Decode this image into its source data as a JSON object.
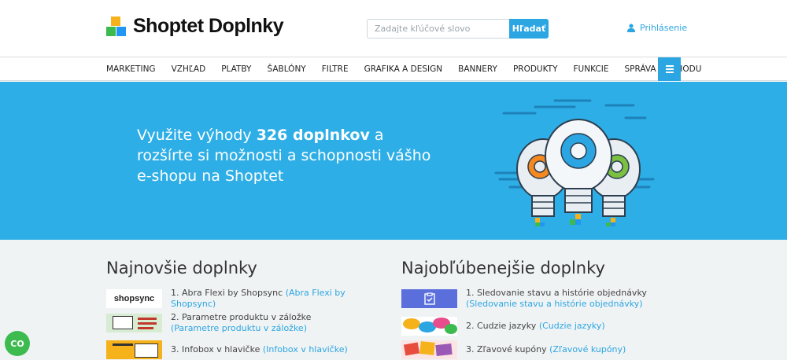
{
  "brand": {
    "name": "Shoptet Doplnky",
    "colors": {
      "yellow": "#f5b21a",
      "green": "#3dba4e",
      "blue": "#2196f3",
      "accent": "#2ba6e2",
      "hero": "#2eaee6"
    }
  },
  "search": {
    "placeholder": "Zadajte kľúčové slovo",
    "button": "Hľadať",
    "icon": "none"
  },
  "login": {
    "label": "Prihlásenie",
    "icon": "user-icon"
  },
  "nav": {
    "items": [
      "MARKETING",
      "VZHĽAD",
      "PLATBY",
      "ŠABLÓNY",
      "FILTRE",
      "GRAFIKA A DESIGN",
      "BANNERY",
      "PRODUKTY",
      "FUNKCIE",
      "SPRÁVA OBCHODU"
    ],
    "menu_icon": "hamburger-icon"
  },
  "hero": {
    "text_before": "Využite výhody ",
    "text_bold": "326 doplnkov",
    "text_after": " a rozšírte si možnosti a schopnosti vášho e-shopu na Shoptet"
  },
  "newest": {
    "title": "Najnovšie doplnky",
    "items": [
      {
        "num": "1.",
        "name": "Abra Flexi by Shopsync",
        "link": "(Abra Flexi by Shopsync)",
        "thumb_label": "shopsync"
      },
      {
        "num": "2.",
        "name": "Parametre produktu v záložke",
        "link": "(Parametre produktu v záložke)",
        "thumb_label": ""
      },
      {
        "num": "3.",
        "name": "Infobox v hlavičke",
        "link": "(Infobox v hlavičke)",
        "thumb_label": ""
      }
    ]
  },
  "popular": {
    "title": "Najobľúbenejšie doplnky",
    "items": [
      {
        "num": "1.",
        "name": "Sledovanie stavu a histórie objednávky",
        "link": "(Sledovanie stavu a histórie objednávky)"
      },
      {
        "num": "2.",
        "name": "Cudzie jazyky",
        "link": "(Cudzie jazyky)"
      },
      {
        "num": "3.",
        "name": "Zľavové kupóny",
        "link": "(Zľavové kupóny)"
      }
    ]
  },
  "chat": {
    "label": "CO"
  }
}
